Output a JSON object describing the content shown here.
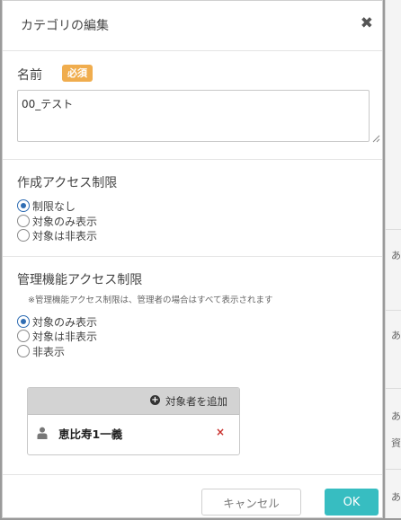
{
  "dialog": {
    "title": "カテゴリの編集",
    "close_glyph": "✖"
  },
  "name_section": {
    "label": "名前",
    "required_badge": "必須",
    "value": "00_テスト"
  },
  "create_access": {
    "title": "作成アクセス制限",
    "options": [
      {
        "label": "制限なし",
        "checked": true
      },
      {
        "label": "対象のみ表示",
        "checked": false
      },
      {
        "label": "対象は非表示",
        "checked": false
      }
    ]
  },
  "admin_access": {
    "title": "管理機能アクセス制限",
    "note": "※管理機能アクセス制限は、管理者の場合はすべて表示されます",
    "options": [
      {
        "label": "対象のみ表示",
        "checked": true
      },
      {
        "label": "対象は非表示",
        "checked": false
      },
      {
        "label": "非表示",
        "checked": false
      }
    ]
  },
  "targets": {
    "add_label": "対象者を追加",
    "plus_glyph": "+",
    "remove_glyph": "×",
    "items": [
      {
        "name": "恵比寿1一義",
        "icon": "person-icon"
      }
    ]
  },
  "footer": {
    "cancel_label": "キャンセル",
    "ok_label": "OK"
  },
  "background": {
    "side_chars": [
      "あ",
      "あ",
      "あ",
      "資",
      "あ"
    ]
  },
  "colors": {
    "accent": "#37bdc1",
    "badge": "#f0ad4e",
    "radio_selected": "#2f6db3",
    "remove": "#c9302c"
  }
}
